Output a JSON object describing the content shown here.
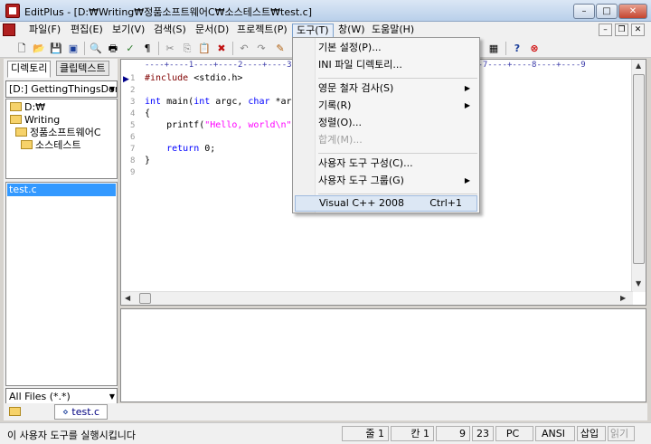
{
  "window": {
    "title": "EditPlus - [D:₩Writing₩정품소프트웨어C₩소스테스트₩test.c]",
    "minimize": "–",
    "maximize": "□",
    "close": "✕",
    "mdi_min": "–",
    "mdi_restore": "❐",
    "mdi_close": "✕"
  },
  "menubar": [
    "파일(F)",
    "편집(E)",
    "보기(V)",
    "검색(S)",
    "문서(D)",
    "프로젝트(P)",
    "도구(T)",
    "창(W)",
    "도움말(H)"
  ],
  "toolbar": {
    "icons": [
      "new-file-icon",
      "open-folder-icon",
      "save-icon",
      "save-all-icon",
      "print-preview-icon",
      "print-icon",
      "spell-check-icon",
      "word-count-icon",
      "cut-icon",
      "copy-icon",
      "paste-icon",
      "delete-icon",
      "undo-icon",
      "redo-icon",
      "find-icon",
      "run-tool-icon",
      "help-icon",
      "stop-icon"
    ],
    "glyphs": {
      "new": "🗋",
      "open": "📂",
      "save": "💾",
      "save_all": "▣",
      "preview": "🔍",
      "print": "🖶",
      "spell": "✓",
      "wc": "¶",
      "cut": "✂",
      "copy": "⎘",
      "paste": "📋",
      "delete": "✖",
      "undo": "↶",
      "redo": "↷",
      "find": "✎",
      "tool": "▦",
      "help": "?",
      "stop": "⊗"
    }
  },
  "left_panel": {
    "tabs": [
      "디렉토리",
      "클립텍스트"
    ],
    "drive_combo": "[D:] GettingThingsDor",
    "tree": [
      "D:₩",
      "Writing",
      "정품소프트웨어C",
      "소스테스트"
    ],
    "files": [
      "test.c"
    ],
    "filter_combo": "All Files (*.*)"
  },
  "editor": {
    "ruler": "----+----1----+----2----+----3----+----4----+----5----+----6----+----7----+----8----+----9",
    "line_numbers": [
      "1",
      "2",
      "3",
      "4",
      "5",
      "6",
      "7",
      "8",
      "9"
    ],
    "code": {
      "l1_kw": "#include",
      "l1_rest": " <stdio.h>",
      "l3_a": "int",
      "l3_b": " main(",
      "l3_c": "int",
      "l3_d": " argc, ",
      "l3_e": "char",
      "l3_f": " *ar",
      "l4": "{",
      "l5_a": "    printf(",
      "l5_b": "\"Hello, world\\n\"",
      "l7_a": "    ",
      "l7_b": "return",
      "l7_c": " 0;",
      "l8": "}"
    }
  },
  "tools_menu": {
    "items": [
      {
        "label": "기본 설정(P)...",
        "submenu": false,
        "disabled": false
      },
      {
        "label": "INI 파일 디렉토리...",
        "submenu": false,
        "disabled": false
      },
      {
        "label": "영문 철자 검사(S)",
        "submenu": true,
        "disabled": false
      },
      {
        "label": "기록(R)",
        "submenu": true,
        "disabled": false
      },
      {
        "label": "정렬(O)...",
        "submenu": false,
        "disabled": false
      },
      {
        "label": "합계(M)...",
        "submenu": false,
        "disabled": true
      },
      {
        "label": "사용자 도구 구성(C)...",
        "submenu": false,
        "disabled": false
      },
      {
        "label": "사용자 도구 그룹(G)",
        "submenu": true,
        "disabled": false
      },
      {
        "label": "Visual C++ 2008",
        "shortcut": "Ctrl+1",
        "submenu": false,
        "disabled": false
      }
    ],
    "submenu_arrow": "▶"
  },
  "doc_tabs": [
    "test.c"
  ],
  "statusbar": {
    "message": "이 사용자 도구를 실행시킵니다",
    "line": "줄 1",
    "col": "칸 1",
    "lines_total": "9",
    "chars": "23",
    "eol": "PC",
    "encoding": "ANSI",
    "insert": "삽입",
    "readonly": "읽기"
  },
  "colors": {
    "selection": "#3399ff",
    "keyword": "#0000ff",
    "string": "#ff00ff",
    "preprocessor": "#800000",
    "ruler": "#3a3aa8"
  }
}
